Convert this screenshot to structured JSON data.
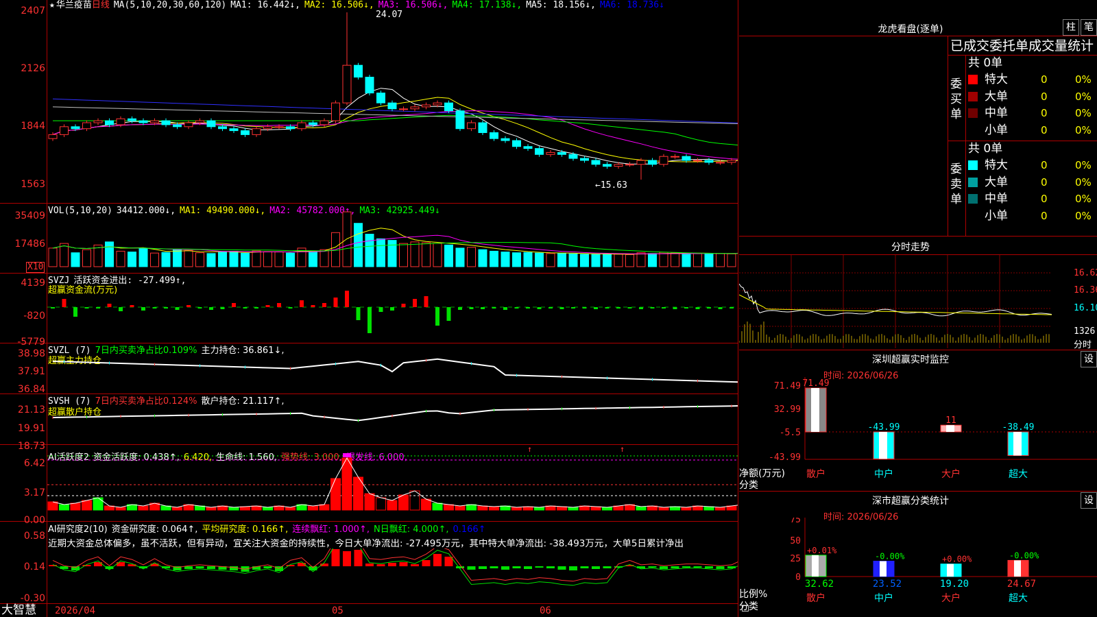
{
  "stock": {
    "name": "华兰疫苗",
    "period": "日线",
    "star": "★"
  },
  "ma_header": {
    "label": "MA(5,10,20,30,60,120)",
    "ma1": "MA1: 16.442↓,",
    "ma2": "MA2: 16.506↓,",
    "ma3": "MA3: 16.506↓,",
    "ma4": "MA4: 17.138↓,",
    "ma5": "MA5: 18.156↓,",
    "ma6": "MA6: 18.736↓"
  },
  "price_axis": [
    "2407",
    "2126",
    "1844",
    "1563"
  ],
  "price_marks": {
    "high": "24.07",
    "low": "←15.63"
  },
  "vol_header": {
    "label": "VOL(5,10,20)",
    "v": "34412.000↓,",
    "ma1": "MA1: 49490.000↓,",
    "ma2": "MA2: 45782.000↑,",
    "ma3": "MA3: 42925.449↓"
  },
  "vol_axis": [
    "35409",
    "17486"
  ],
  "vol_unit": "X10",
  "svzj": {
    "label": "SVZJ",
    "text": "活跃资金进出: -27.499↑,",
    "sub": "超赢资金流(万元)",
    "axis": [
      "4139",
      "-820",
      "-5779"
    ]
  },
  "svzl": {
    "label": "SVZL (7)",
    "text1": "7日内买卖净占比0.109%",
    "text2": "主力持仓: 36.861↓,",
    "sub": "超赢主力持仓",
    "axis": [
      "38.98",
      "37.91",
      "36.84"
    ]
  },
  "svsh": {
    "label": "SVSH (7)",
    "text1": "7日内买卖净占比0.124%",
    "text2": "散户持仓: 21.117↑,",
    "sub": "超赢散户持仓",
    "axis": [
      "21.13",
      "19.91",
      "18.73"
    ]
  },
  "ai_active": {
    "label": "AI活跃度2",
    "t1": "资金活跃度: 0.438↑,",
    "t2": "6.420,",
    "t3": "生命线: 1.560,",
    "t4": "强势线: 3.000,",
    "t5": "爆发线: 6.000,",
    "axis": [
      "6.42",
      "3.17",
      "0.00"
    ]
  },
  "ai_research": {
    "label": "AI研究度2(10)",
    "t1": "资金研究度: 0.064↑,",
    "t2": "平均研究度: 0.166↑,",
    "t3": "连续飘红: 1.000↑,",
    "t4": "N日飘红: 4.000↑,",
    "t5": "0.166↑",
    "comment": "近期大资金总体偏多，虽不活跃，但有异动，宜关注大资金的持续性，今日大单净流出: -27.495万元，其中特大单净流出: -38.493万元，大单5日累计净出",
    "axis": [
      "0.58",
      "0.14",
      "-0.30"
    ]
  },
  "bottom": {
    "brand": "大智慧",
    "dates": [
      "2026/04",
      "05",
      "06"
    ]
  },
  "lhb": {
    "title": "龙虎看盘(逐单)",
    "btn1": "柱",
    "btn2": "笔",
    "subtitle": "已成交委托单成交量统计",
    "buy_label": "委买单",
    "sell_label": "委卖单",
    "buy_total": "共 0单",
    "sell_total": "共 0单",
    "buy_rows": [
      {
        "name": "特大",
        "n": "0",
        "p": "0%",
        "color": "#ff0000"
      },
      {
        "name": "大单",
        "n": "0",
        "p": "0%",
        "color": "#a00000"
      },
      {
        "name": "中单",
        "n": "0",
        "p": "0%",
        "color": "#700000"
      },
      {
        "name": "小单",
        "n": "0",
        "p": "0%",
        "color": "#000000"
      }
    ],
    "sell_rows": [
      {
        "name": "特大",
        "n": "0",
        "p": "0%",
        "color": "#00ffff"
      },
      {
        "name": "大单",
        "n": "0",
        "p": "0%",
        "color": "#00a0a0"
      },
      {
        "name": "中单",
        "n": "0",
        "p": "0%",
        "color": "#007070"
      },
      {
        "name": "小单",
        "n": "0",
        "p": "0%",
        "color": "#000000"
      }
    ]
  },
  "fenshi": {
    "title": "分时走势",
    "axis": [
      "16.62",
      "16.36",
      "16.10",
      "1326",
      "分时"
    ]
  },
  "szcy": {
    "title": "深圳超赢实时监控",
    "btn": "设",
    "time": "时间: 2026/06/26",
    "axis": [
      "71.49",
      "32.99",
      "-5.5",
      "-43.99"
    ],
    "ylabel1": "净额(万元)",
    "ylabel2": "分类",
    "bars": [
      {
        "cat": "散户",
        "val": "71.49"
      },
      {
        "cat": "中户",
        "val": "-43.99"
      },
      {
        "cat": "大户",
        "val": "11"
      },
      {
        "cat": "超大",
        "val": "-38.49"
      }
    ]
  },
  "sscf": {
    "title": "深市超赢分类统计",
    "btn": "设",
    "time": "时间: 2026/06/26",
    "axis": [
      "75",
      "50",
      "25",
      "0"
    ],
    "ylabel1": "比例%",
    "ylabel2": "分类",
    "bars": [
      {
        "cat": "散户",
        "top": "+0.01%",
        "val": "32.62"
      },
      {
        "cat": "中户",
        "top": "-0.00%",
        "val": "23.52"
      },
      {
        "cat": "大户",
        "top": "+0.00%",
        "val": "19.20"
      },
      {
        "cat": "超大",
        "top": "-0.00%",
        "val": "24.67"
      }
    ]
  },
  "chart_data": {
    "type": "candlestick",
    "title": "华兰疫苗 日线",
    "close": [
      17.9,
      18.3,
      18.2,
      18.5,
      18.6,
      18.4,
      18.7,
      18.6,
      18.5,
      18.6,
      18.4,
      18.3,
      18.5,
      18.6,
      18.3,
      18.2,
      18.1,
      17.9,
      18.2,
      18.3,
      18.3,
      18.2,
      18.5,
      18.4,
      18.6,
      19.5,
      21.4,
      20.8,
      20.0,
      19.5,
      19.2,
      19.2,
      19.3,
      19.4,
      19.5,
      19.1,
      18.2,
      18.5,
      18.0,
      17.7,
      17.6,
      17.3,
      17.2,
      16.9,
      17.0,
      16.9,
      16.7,
      16.6,
      16.4,
      16.3,
      16.4,
      16.4,
      16.6,
      16.4,
      16.8,
      16.8,
      16.6,
      16.6,
      16.5,
      16.5,
      16.6,
      16.9,
      16.7,
      16.6,
      16.4
    ],
    "volume": [
      12000,
      15000,
      9000,
      11000,
      14000,
      16000,
      10000,
      9500,
      12000,
      8800,
      9200,
      11000,
      10500,
      9000,
      8500,
      9800,
      9900,
      8700,
      10200,
      9700,
      9500,
      8800,
      12000,
      9500,
      11000,
      22000,
      35400,
      28000,
      21000,
      18000,
      17000,
      15000,
      16000,
      15500,
      15000,
      14000,
      12000,
      12500,
      11000,
      10000,
      9500,
      9000,
      9200,
      8800,
      8500,
      8700,
      8300,
      8000,
      7900,
      8200,
      8100,
      7800,
      9000,
      8500,
      9300,
      8800,
      8600,
      8400,
      8200,
      8500,
      8300,
      10000,
      9000,
      8600,
      8000
    ]
  }
}
